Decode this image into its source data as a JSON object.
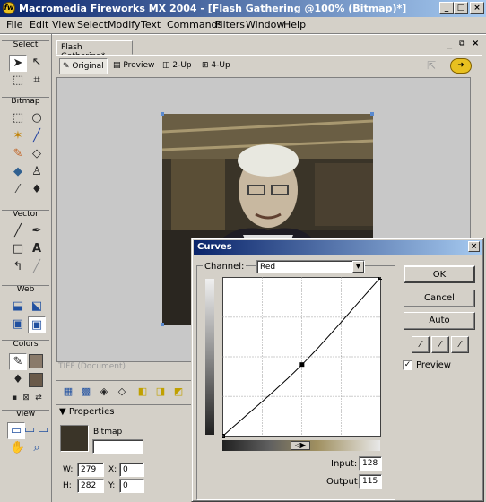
{
  "window": {
    "title": "Macromedia Fireworks MX 2004 - [Flash Gathering @100% (Bitmap)*]",
    "min_glyph": "_",
    "max_glyph": "□",
    "close_glyph": "×"
  },
  "menu": [
    "File",
    "Edit",
    "View",
    "Select",
    "Modify",
    "Text",
    "Commands",
    "Filters",
    "Window",
    "Help"
  ],
  "tools": {
    "sections": {
      "select": "Select",
      "bitmap": "Bitmap",
      "vector": "Vector",
      "web": "Web",
      "colors": "Colors",
      "view": "View"
    }
  },
  "document": {
    "tab": "Flash Gathering*",
    "views": {
      "original": "Original",
      "preview": "Preview",
      "two_up": "2-Up",
      "four_up": "4-Up"
    },
    "status": "TIFF (Document)"
  },
  "properties": {
    "title": "Properties",
    "object_type": "Bitmap",
    "w_label": "W:",
    "w": "279",
    "h_label": "H:",
    "h": "282",
    "x_label": "X:",
    "x": "0",
    "y_label": "Y:",
    "y": "0"
  },
  "curves": {
    "title": "Curves",
    "channel_label": "Channel:",
    "channel": "Red",
    "ok": "OK",
    "cancel": "Cancel",
    "auto": "Auto",
    "preview_label": "Preview",
    "preview_checked": true,
    "input_label": "Input:",
    "input": "128",
    "output_label": "Output:",
    "output": "115"
  },
  "chart_data": {
    "type": "line",
    "title": "",
    "xlabel": "",
    "ylabel": "",
    "xlim": [
      0,
      255
    ],
    "ylim": [
      0,
      255
    ],
    "series": [
      {
        "x": [
          0,
          128,
          255
        ],
        "y": [
          0,
          115,
          255
        ]
      }
    ],
    "selected_point": {
      "x": 128,
      "y": 115
    },
    "grid": "quarters"
  }
}
